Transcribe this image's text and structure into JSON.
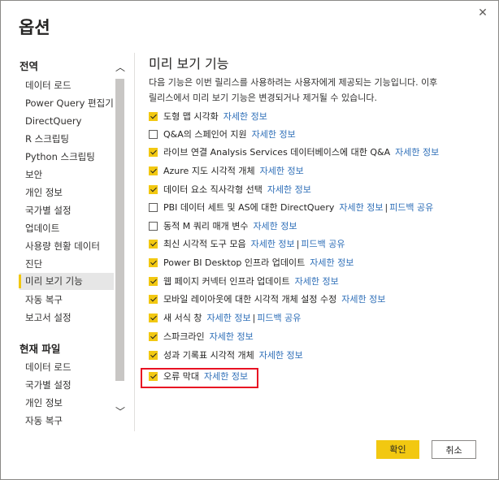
{
  "dialog": {
    "title": "옵션",
    "close_glyph": "✕"
  },
  "sidebar": {
    "global_header": "전역",
    "global_items": [
      "데이터 로드",
      "Power Query 편집기",
      "DirectQuery",
      "R 스크립팅",
      "Python 스크립팅",
      "보안",
      "개인 정보",
      "국가별 설정",
      "업데이트",
      "사용량 현황 데이터",
      "진단",
      "미리 보기 기능",
      "자동 복구",
      "보고서 설정"
    ],
    "selected_item": "미리 보기 기능",
    "file_header": "현재 파일",
    "file_items": [
      "데이터 로드",
      "국가별 설정",
      "개인 정보",
      "자동 복구"
    ],
    "scroll_up_glyph": "︿",
    "scroll_down_glyph": "﹀"
  },
  "content": {
    "title": "미리 보기 기능",
    "description_line1": "다음 기능은 이번 릴리스를 사용하려는 사용자에게 제공되는 기능입니다. 이후",
    "description_line2": "릴리스에서 미리 보기 기능은 변경되거나 제거될 수 있습니다.",
    "features": [
      {
        "label": "도형 맵 시각화",
        "checked": true,
        "link": "자세한 정보"
      },
      {
        "label": "Q&A의 스페인어 지원",
        "checked": false,
        "link": "자세한 정보"
      },
      {
        "label": "라이브 연결 Analysis Services 데이터베이스에 대한 Q&A",
        "checked": true,
        "link": "자세한 정보"
      },
      {
        "label": "Azure 지도 시각적 개체",
        "checked": true,
        "link": "자세한 정보"
      },
      {
        "label": "데이터 요소 직사각형 선택",
        "checked": true,
        "link": "자세한 정보"
      },
      {
        "label": "PBI 데이터 세트 및 AS에 대한 DirectQuery",
        "checked": false,
        "link": "자세한 정보",
        "link2": "피드백 공유"
      },
      {
        "label": "동적 M 쿼리 매개 변수",
        "checked": false,
        "link": "자세한 정보"
      },
      {
        "label": "최신 시각적 도구 모음",
        "checked": true,
        "link": "자세한 정보",
        "link2": "피드백 공유"
      },
      {
        "label": "Power BI Desktop 인프라 업데이트",
        "checked": true,
        "link": "자세한 정보"
      },
      {
        "label": "웹 페이지 커넥터 인프라 업데이트",
        "checked": true,
        "link": "자세한 정보"
      },
      {
        "label": "모바일 레이아웃에 대한 시각적 개체 설정 수정",
        "checked": true,
        "link": "자세한 정보"
      },
      {
        "label": "새 서식 창",
        "checked": true,
        "link": "자세한 정보",
        "link2": "피드백 공유"
      },
      {
        "label": "스파크라인",
        "checked": true,
        "link": "자세한 정보"
      },
      {
        "label": "성과 기록표 시각적 개체",
        "checked": true,
        "link": "자세한 정보"
      },
      {
        "label": "오류 막대",
        "checked": true,
        "link": "자세한 정보"
      }
    ],
    "link_separator": "|"
  },
  "footer": {
    "ok_label": "확인",
    "cancel_label": "취소"
  },
  "colors": {
    "accent": "#f2c811",
    "link": "#2f6fb8",
    "highlight": "#e81123"
  }
}
